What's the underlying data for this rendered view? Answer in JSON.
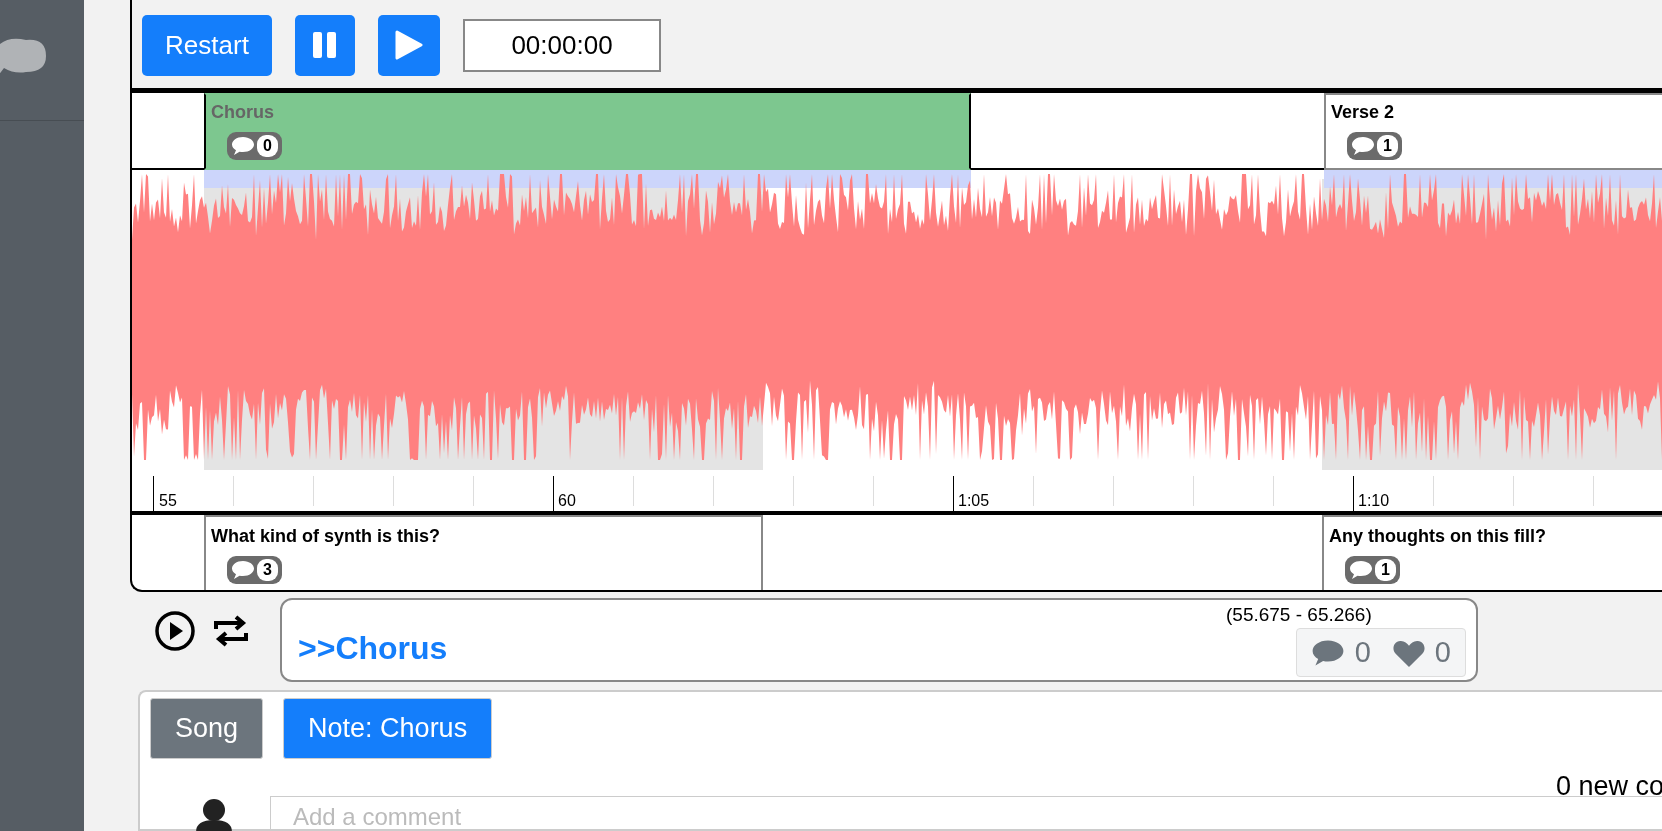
{
  "toolbar": {
    "restart": "Restart",
    "time": "00:00:00"
  },
  "sections": [
    {
      "label": "Chorus",
      "comments": "0",
      "selected": true
    },
    {
      "label": "Verse 2",
      "comments": "1",
      "selected": false
    }
  ],
  "axis_labels": [
    "55",
    "60",
    "1:05",
    "1:10"
  ],
  "notes": [
    {
      "label": "What kind of synth is this?",
      "comments": "3"
    },
    {
      "label": "Any thoughts on this fill?",
      "comments": "1"
    }
  ],
  "detail": {
    "title": ">>Chorus",
    "range": "(55.675 - 65.266)",
    "comments": "0",
    "likes": "0"
  },
  "tabs": [
    {
      "label": "Song",
      "selected": false
    },
    {
      "label": "Note: Chorus",
      "selected": true
    }
  ],
  "new_comments": "0 new co",
  "comment": {
    "placeholder": "Add a comment"
  }
}
